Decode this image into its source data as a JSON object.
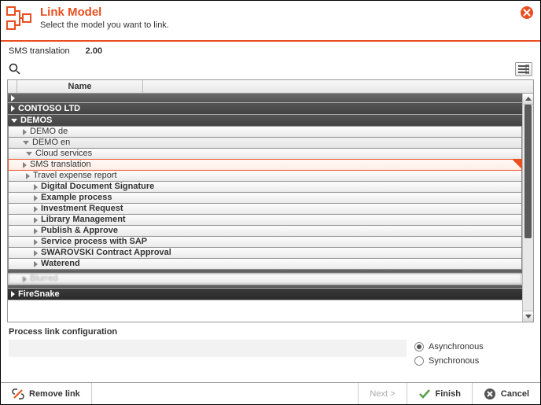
{
  "header": {
    "title": "Link Model",
    "subtitle": "Select the model you want to link."
  },
  "info": {
    "label": "SMS translation",
    "version": "2.00"
  },
  "columns": {
    "name": "Name"
  },
  "tree": {
    "root1": "CONTOSO LTD",
    "root2": "DEMOS",
    "demo_de": "DEMO de",
    "demo_en": "DEMO en",
    "cloud": "Cloud services",
    "sms": "SMS translation",
    "travel": "Travel expense report",
    "items": [
      "Digital Document Signature",
      "Example process",
      "Investment Request",
      "Library Management",
      "Publish & Approve",
      "Service process with SAP",
      "SWAROVSKI Contract Approval",
      "Waterend"
    ],
    "blurred": "Blurred",
    "firesnake": "FireSnake"
  },
  "config": {
    "title": "Process link configuration",
    "async": "Asynchronous",
    "sync": "Synchronous",
    "selected": "async"
  },
  "footer": {
    "remove": "Remove link",
    "next": "Next >",
    "finish": "Finish",
    "cancel": "Cancel"
  }
}
